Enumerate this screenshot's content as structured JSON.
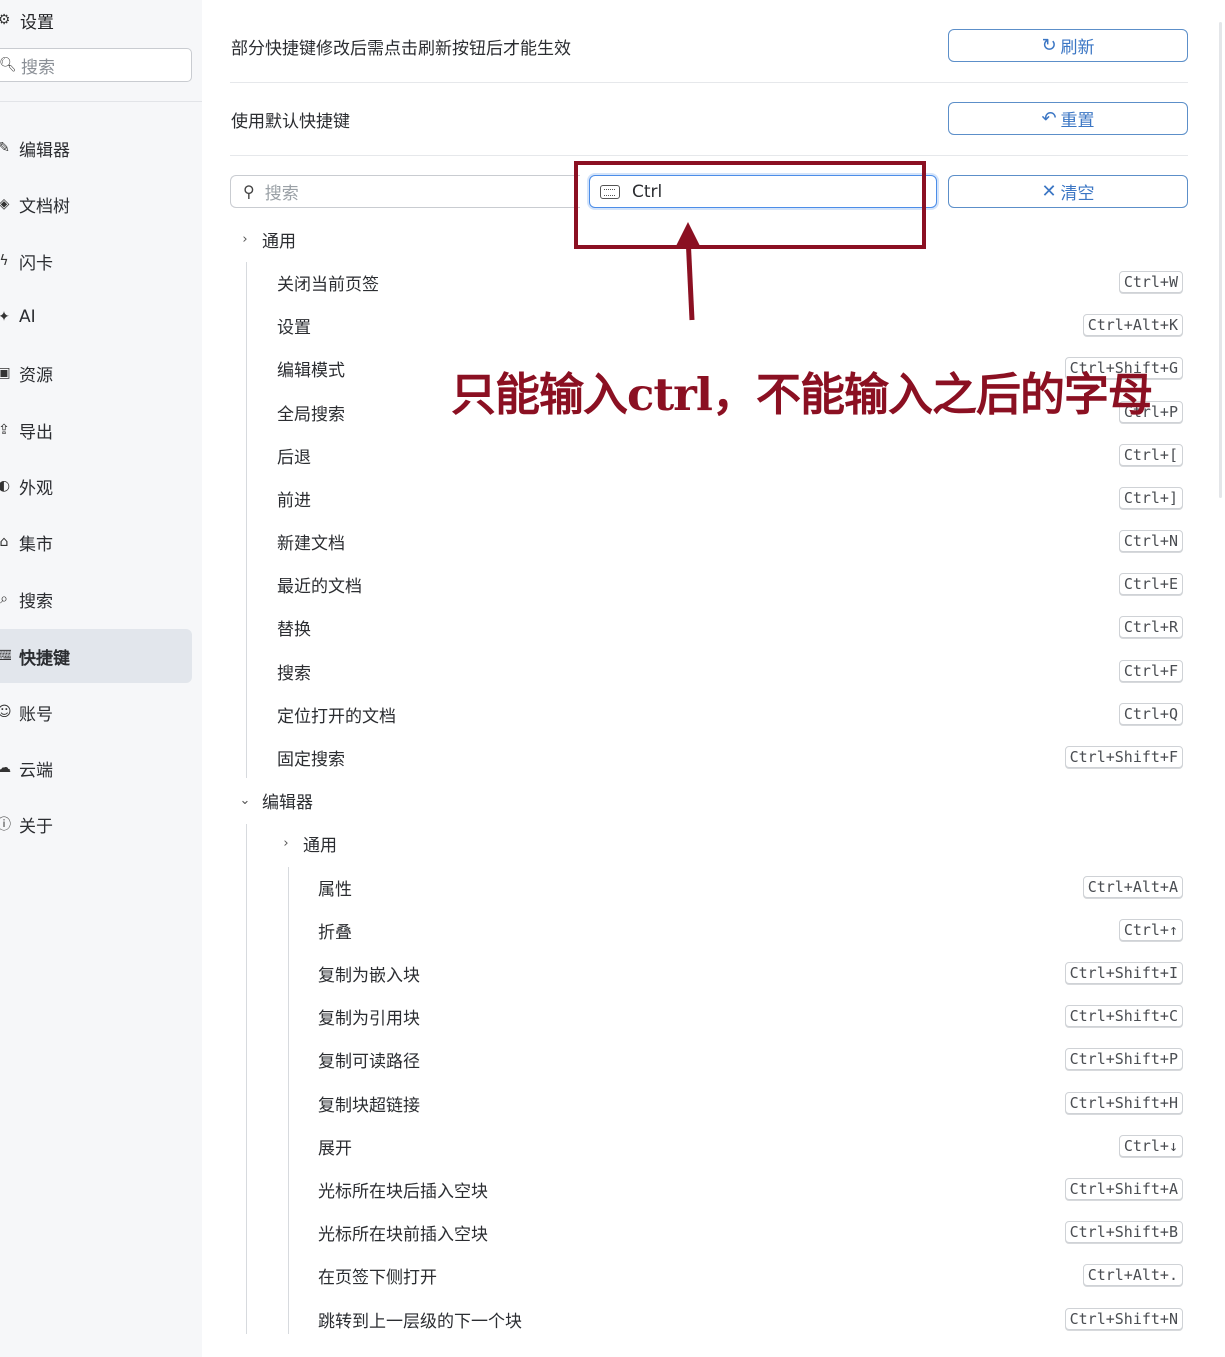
{
  "sidebar": {
    "title": "设置",
    "search_placeholder": "搜索",
    "items": [
      {
        "label": "编辑器",
        "icon": "pen-icon"
      },
      {
        "label": "文档树",
        "icon": "layers-icon"
      },
      {
        "label": "闪卡",
        "icon": "flash-icon"
      },
      {
        "label": "AI",
        "icon": "sparkle-icon"
      },
      {
        "label": "资源",
        "icon": "image-icon"
      },
      {
        "label": "导出",
        "icon": "export-icon"
      },
      {
        "label": "外观",
        "icon": "theme-icon"
      },
      {
        "label": "集市",
        "icon": "store-icon"
      },
      {
        "label": "搜索",
        "icon": "search-icon"
      },
      {
        "label": "快捷键",
        "icon": "keyboard-icon",
        "active": true
      },
      {
        "label": "账号",
        "icon": "account-icon"
      },
      {
        "label": "云端",
        "icon": "cloud-icon"
      },
      {
        "label": "关于",
        "icon": "info-icon"
      }
    ]
  },
  "main": {
    "refresh_hint": "部分快捷键修改后需点击刷新按钮后才能生效",
    "refresh_label": "刷新",
    "default_label": "使用默认快捷键",
    "reset_label": "重置",
    "search_placeholder": "搜索",
    "key_input_value": "Ctrl",
    "clear_label": "清空",
    "groups": {
      "general": {
        "title": "通用",
        "items": [
          {
            "name": "关闭当前页签",
            "key": "Ctrl+W"
          },
          {
            "name": "设置",
            "key": "Ctrl+Alt+K"
          },
          {
            "name": "编辑模式",
            "key": "Ctrl+Shift+G"
          },
          {
            "name": "全局搜索",
            "key": "Ctrl+P"
          },
          {
            "name": "后退",
            "key": "Ctrl+["
          },
          {
            "name": "前进",
            "key": "Ctrl+]"
          },
          {
            "name": "新建文档",
            "key": "Ctrl+N"
          },
          {
            "name": "最近的文档",
            "key": "Ctrl+E"
          },
          {
            "name": "替换",
            "key": "Ctrl+R"
          },
          {
            "name": "搜索",
            "key": "Ctrl+F"
          },
          {
            "name": "定位打开的文档",
            "key": "Ctrl+Q"
          },
          {
            "name": "固定搜索",
            "key": "Ctrl+Shift+F"
          }
        ]
      },
      "editor": {
        "title": "编辑器",
        "sub_title": "通用",
        "items": [
          {
            "name": "属性",
            "key": "Ctrl+Alt+A"
          },
          {
            "name": "折叠",
            "key": "Ctrl+↑"
          },
          {
            "name": "复制为嵌入块",
            "key": "Ctrl+Shift+I"
          },
          {
            "name": "复制为引用块",
            "key": "Ctrl+Shift+C"
          },
          {
            "name": "复制可读路径",
            "key": "Ctrl+Shift+P"
          },
          {
            "name": "复制块超链接",
            "key": "Ctrl+Shift+H"
          },
          {
            "name": "展开",
            "key": "Ctrl+↓"
          },
          {
            "name": "光标所在块后插入空块",
            "key": "Ctrl+Shift+A"
          },
          {
            "name": "光标所在块前插入空块",
            "key": "Ctrl+Shift+B"
          },
          {
            "name": "在页签下侧打开",
            "key": "Ctrl+Alt+."
          },
          {
            "name": "跳转到上一层级的下一个块",
            "key": "Ctrl+Shift+N"
          }
        ]
      }
    }
  },
  "annotation": {
    "text": "只能输入ctrl，不能输入之后的字母",
    "color": "#8b1022"
  }
}
